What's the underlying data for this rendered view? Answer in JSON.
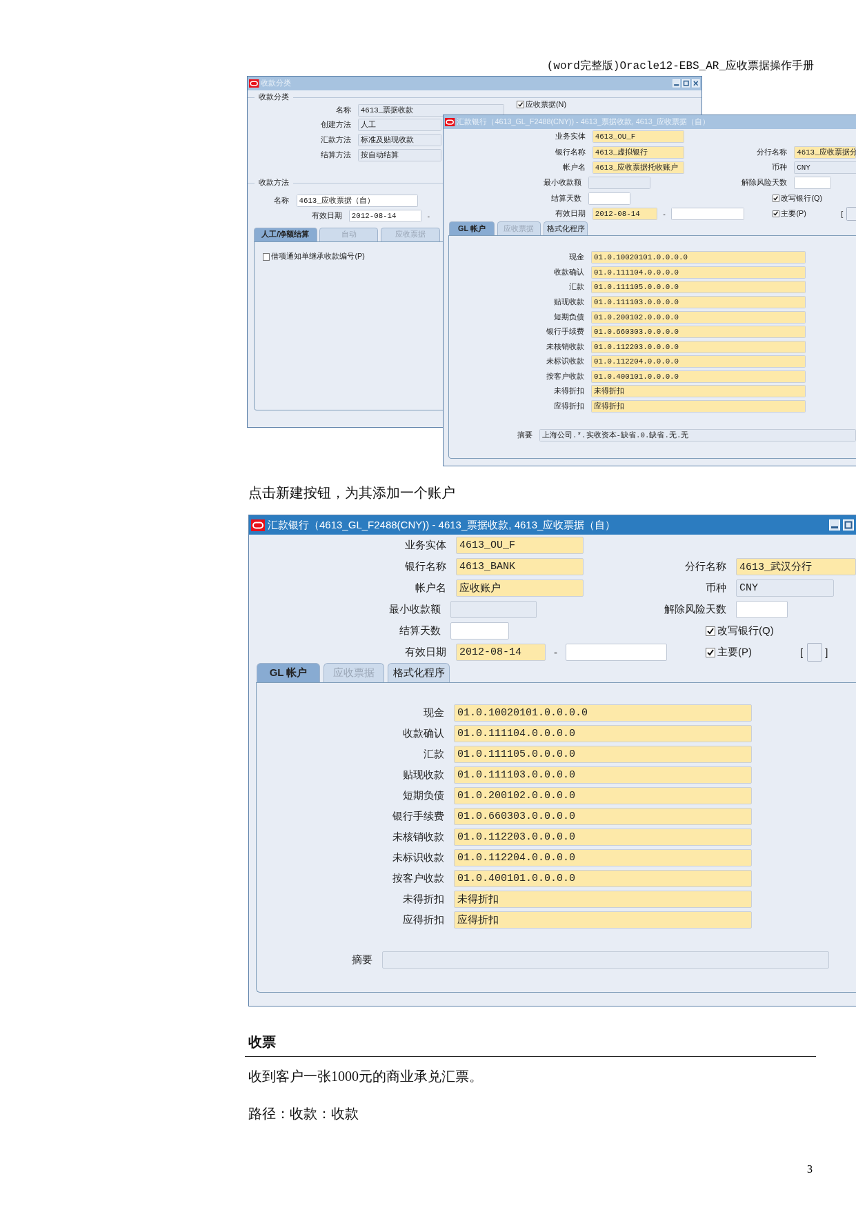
{
  "header": "(word完整版)Oracle12-EBS_AR_应收票据操作手册",
  "screenshot_1": {
    "receipt_class_window": {
      "title": "收款分类",
      "active": false,
      "section_1": "收款分类",
      "fields": [
        {
          "label": "名称",
          "value": "4613_票据收款",
          "kind": "readonly"
        },
        {
          "label": "创建方法",
          "value": "人工",
          "kind": "readonly"
        },
        {
          "label": "汇款方法",
          "value": "标准及贴现收款",
          "kind": "readonly"
        },
        {
          "label": "结算方法",
          "value": "按自动结算",
          "kind": "readonly"
        }
      ],
      "notes_receivable": {
        "label": "应收票据(N)",
        "checked": true
      },
      "section_2": "收款方法",
      "method_name": {
        "label": "名称",
        "value": "4613_应收票据（自）",
        "kind": "optional"
      },
      "effective_date": {
        "label": "有效日期",
        "value": "2012-08-14",
        "kind": "optional",
        "dash": "-"
      },
      "tabs": [
        {
          "label": "人工/净额结算",
          "selected": true,
          "disabled": false
        },
        {
          "label": "自动",
          "selected": false,
          "disabled": true
        },
        {
          "label": "应收票据",
          "selected": false,
          "disabled": true
        }
      ],
      "inherit_number": {
        "label": "借项通知单继承收款编号(P)",
        "checked": false
      }
    },
    "bank_window": {
      "title": "汇款银行（4613_GL_F2488(CNY)) - 4613_票据收款, 4613_应收票据（自）",
      "active": false,
      "operating_unit": {
        "label": "业务实体",
        "value": "4613_OU_F",
        "kind": "required"
      },
      "bank_name": {
        "label": "银行名称",
        "value": "4613_虚拟银行",
        "kind": "required"
      },
      "branch_name": {
        "label": "分行名称",
        "value": "4613_应收票据分",
        "kind": "required"
      },
      "account_name": {
        "label": "帐户名",
        "value": "4613_应收票据托收账户",
        "kind": "required"
      },
      "currency": {
        "label": "币种",
        "value": "CNY",
        "kind": "readonly"
      },
      "min_receipt": {
        "label": "最小收款额",
        "kind": "readonly"
      },
      "risk_days": {
        "label": "解除风险天数",
        "kind": "optional"
      },
      "settlement_days": {
        "label": "结算天数",
        "kind": "optional"
      },
      "override_bank": {
        "label": "改写银行(Q)",
        "checked": true
      },
      "effective_date": {
        "label": "有效日期",
        "value": "2012-08-14",
        "kind": "required",
        "dash": "-"
      },
      "end_date": {
        "kind": "optional"
      },
      "primary": {
        "label": "主要(P)",
        "checked": true
      },
      "flexfield": {
        "open": "["
      },
      "tabs": [
        {
          "label": "GL 帐户",
          "selected": true,
          "disabled": false
        },
        {
          "label": "应收票据",
          "selected": false,
          "disabled": true
        },
        {
          "label": "格式化程序",
          "selected": false,
          "disabled": false
        }
      ],
      "accounts": [
        {
          "label": "现金",
          "value": "01.0.10020101.0.0.0.0"
        },
        {
          "label": "收款确认",
          "value": "01.0.111104.0.0.0.0"
        },
        {
          "label": "汇款",
          "value": "01.0.111105.0.0.0.0"
        },
        {
          "label": "贴现收款",
          "value": "01.0.111103.0.0.0.0"
        },
        {
          "label": "短期负债",
          "value": "01.0.200102.0.0.0.0"
        },
        {
          "label": "银行手续费",
          "value": "01.0.660303.0.0.0.0"
        },
        {
          "label": "未核销收款",
          "value": "01.0.112203.0.0.0.0"
        },
        {
          "label": "未标识收款",
          "value": "01.0.112204.0.0.0.0"
        },
        {
          "label": "按客户收款",
          "value": "01.0.400101.0.0.0.0"
        },
        {
          "label": "未得折扣",
          "value": "未得折扣"
        },
        {
          "label": "应得折扣",
          "value": "应得折扣"
        }
      ],
      "summary": {
        "label": "摘要",
        "value": "上海公司.*.实收资本-缺省.0.缺省.无.无"
      }
    }
  },
  "caption": "点击新建按钮，为其添加一个账户",
  "screenshot_2": {
    "bank_window": {
      "title": "汇款银行（4613_GL_F2488(CNY)) - 4613_票据收款, 4613_应收票据（自）",
      "active": true,
      "operating_unit": {
        "label": "业务实体",
        "value": "4613_OU_F",
        "kind": "required"
      },
      "bank_name": {
        "label": "银行名称",
        "value": "4613_BANK",
        "kind": "required"
      },
      "branch_name": {
        "label": "分行名称",
        "value": "4613_武汉分行",
        "kind": "required"
      },
      "account_name": {
        "label": "帐户名",
        "value": "应收账户",
        "kind": "required"
      },
      "currency": {
        "label": "币种",
        "value": "CNY",
        "kind": "readonly"
      },
      "min_receipt": {
        "label": "最小收款额",
        "kind": "readonly"
      },
      "risk_days": {
        "label": "解除风险天数",
        "kind": "optional"
      },
      "settlement_days": {
        "label": "结算天数",
        "kind": "optional"
      },
      "override_bank": {
        "label": "改写银行(Q)",
        "checked": true
      },
      "effective_date": {
        "label": "有效日期",
        "value": "2012-08-14",
        "kind": "required",
        "dash": "-"
      },
      "end_date": {
        "kind": "optional"
      },
      "primary": {
        "label": "主要(P)",
        "checked": true
      },
      "flexfield": {
        "open": "[",
        "close": "]"
      },
      "tabs": [
        {
          "label": "GL 帐户",
          "selected": true,
          "disabled": false
        },
        {
          "label": "应收票据",
          "selected": false,
          "disabled": true
        },
        {
          "label": "格式化程序",
          "selected": false,
          "disabled": false
        }
      ],
      "accounts": [
        {
          "label": "现金",
          "value": "01.0.10020101.0.0.0.0"
        },
        {
          "label": "收款确认",
          "value": "01.0.111104.0.0.0.0"
        },
        {
          "label": "汇款",
          "value": "01.0.111105.0.0.0.0"
        },
        {
          "label": "贴现收款",
          "value": "01.0.111103.0.0.0.0"
        },
        {
          "label": "短期负债",
          "value": "01.0.200102.0.0.0.0"
        },
        {
          "label": "银行手续费",
          "value": "01.0.660303.0.0.0.0"
        },
        {
          "label": "未核销收款",
          "value": "01.0.112203.0.0.0.0"
        },
        {
          "label": "未标识收款",
          "value": "01.0.112204.0.0.0.0"
        },
        {
          "label": "按客户收款",
          "value": "01.0.400101.0.0.0.0"
        },
        {
          "label": "未得折扣",
          "value": "未得折扣"
        },
        {
          "label": "应得折扣",
          "value": "应得折扣"
        }
      ],
      "summary": {
        "label": "摘要"
      }
    }
  },
  "heading": "收票",
  "paragraphs": [
    "收到客户一张1000元的商业承兑汇票。",
    "路径：收款：收款"
  ],
  "page_number": "3"
}
